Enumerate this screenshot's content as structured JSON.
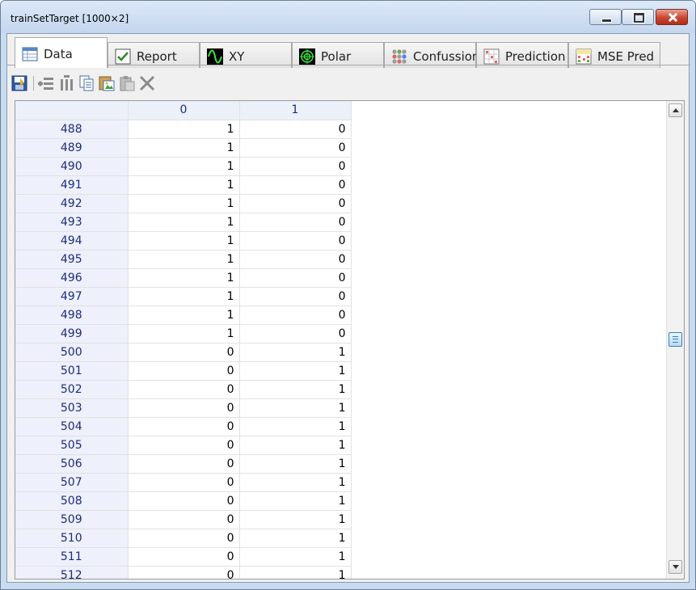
{
  "window": {
    "title": "trainSetTarget [1000×2]"
  },
  "tabs": [
    {
      "label": "Data",
      "icon": "table-icon",
      "active": true
    },
    {
      "label": "Report",
      "icon": "checkmark-icon",
      "active": false
    },
    {
      "label": "XY",
      "icon": "sine-wave-icon",
      "active": false
    },
    {
      "label": "Polar",
      "icon": "polar-icon",
      "active": false
    },
    {
      "label": "Confussion",
      "icon": "dots-matrix-icon",
      "active": false
    },
    {
      "label": "Prediction",
      "icon": "grid-chart-icon",
      "active": false
    },
    {
      "label": "MSE Pred",
      "icon": "mse-icon",
      "active": false
    }
  ],
  "toolbar": [
    "save-icon",
    "insert-row-icon",
    "insert-column-icon",
    "copy-icon",
    "paste-image-icon",
    "paste-icon",
    "delete-icon"
  ],
  "grid": {
    "columns": [
      "0",
      "1"
    ],
    "rows": [
      {
        "index": "488",
        "values": [
          "1",
          "0"
        ]
      },
      {
        "index": "489",
        "values": [
          "1",
          "0"
        ]
      },
      {
        "index": "490",
        "values": [
          "1",
          "0"
        ]
      },
      {
        "index": "491",
        "values": [
          "1",
          "0"
        ]
      },
      {
        "index": "492",
        "values": [
          "1",
          "0"
        ]
      },
      {
        "index": "493",
        "values": [
          "1",
          "0"
        ]
      },
      {
        "index": "494",
        "values": [
          "1",
          "0"
        ]
      },
      {
        "index": "495",
        "values": [
          "1",
          "0"
        ]
      },
      {
        "index": "496",
        "values": [
          "1",
          "0"
        ]
      },
      {
        "index": "497",
        "values": [
          "1",
          "0"
        ]
      },
      {
        "index": "498",
        "values": [
          "1",
          "0"
        ]
      },
      {
        "index": "499",
        "values": [
          "1",
          "0"
        ]
      },
      {
        "index": "500",
        "values": [
          "0",
          "1"
        ]
      },
      {
        "index": "501",
        "values": [
          "0",
          "1"
        ]
      },
      {
        "index": "502",
        "values": [
          "0",
          "1"
        ]
      },
      {
        "index": "503",
        "values": [
          "0",
          "1"
        ]
      },
      {
        "index": "504",
        "values": [
          "0",
          "1"
        ]
      },
      {
        "index": "505",
        "values": [
          "0",
          "1"
        ]
      },
      {
        "index": "506",
        "values": [
          "0",
          "1"
        ]
      },
      {
        "index": "507",
        "values": [
          "0",
          "1"
        ]
      },
      {
        "index": "508",
        "values": [
          "0",
          "1"
        ]
      },
      {
        "index": "509",
        "values": [
          "0",
          "1"
        ]
      },
      {
        "index": "510",
        "values": [
          "0",
          "1"
        ]
      },
      {
        "index": "511",
        "values": [
          "0",
          "1"
        ]
      },
      {
        "index": "512",
        "values": [
          "0",
          "1"
        ]
      }
    ]
  }
}
